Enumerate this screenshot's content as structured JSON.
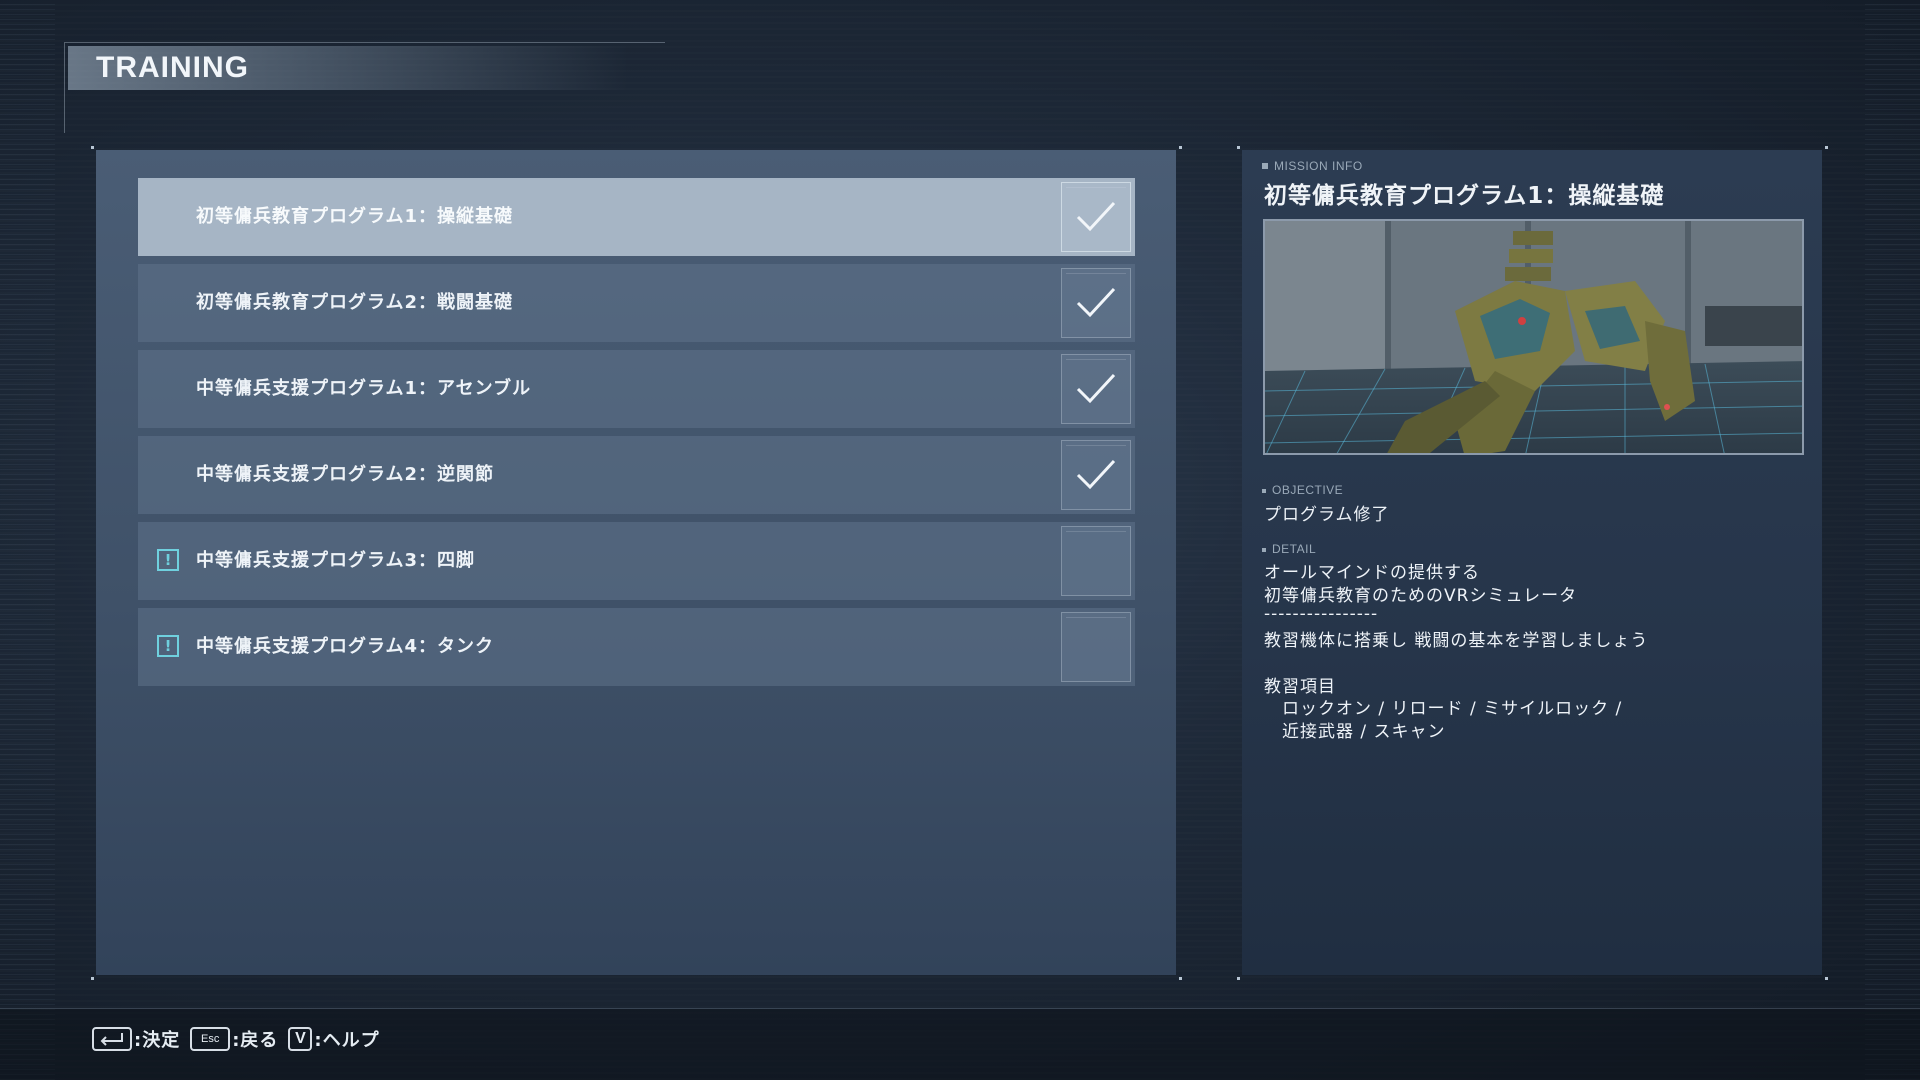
{
  "screen": {
    "title": "TRAINING"
  },
  "missions": [
    {
      "label": "初等傭兵教育プログラム1：操縦基礎",
      "status": "completed",
      "selected": true
    },
    {
      "label": "初等傭兵教育プログラム2：戦闘基礎",
      "status": "completed",
      "selected": false
    },
    {
      "label": "中等傭兵支援プログラム1：アセンブル",
      "status": "completed",
      "selected": false
    },
    {
      "label": "中等傭兵支援プログラム2：逆関節",
      "status": "completed",
      "selected": false
    },
    {
      "label": "中等傭兵支援プログラム3：四脚",
      "status": "new",
      "alert_icon": "!",
      "selected": false
    },
    {
      "label": "中等傭兵支援プログラム4：タンク",
      "status": "new",
      "alert_icon": "!",
      "selected": false
    }
  ],
  "mission_info": {
    "header": "MISSION INFO",
    "title": "初等傭兵教育プログラム1：操縦基礎",
    "objective_header": "OBJECTIVE",
    "objective": "プログラム修了",
    "detail_header": "DETAIL",
    "detail_lines": [
      "オールマインドの提供する",
      "初等傭兵教育のためのVRシミュレータ",
      "----------------",
      "教習機体に搭乗し 戦闘の基本を学習しましょう",
      "教習項目",
      "　ロックオン / リロード / ミサイルロック /",
      "　近接武器 / スキャン"
    ]
  },
  "controls": {
    "confirm_label": ":決定",
    "back_key": "Esc",
    "back_label": ":戻る",
    "help_key": "V",
    "help_label": ":ヘルプ"
  },
  "colors": {
    "selected_row": "#a6b5c5",
    "alert_accent": "#6fd0de",
    "panel": "#3f5168"
  },
  "icons": {
    "completed": "check-icon",
    "new": "alert-icon",
    "confirm_key": "enter-key-icon"
  }
}
